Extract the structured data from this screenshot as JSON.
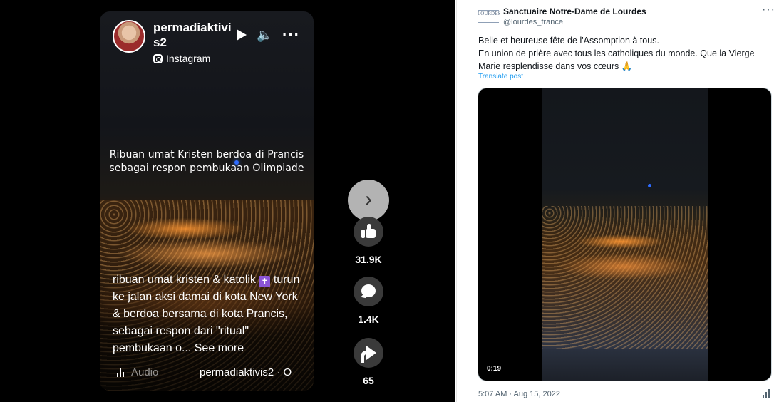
{
  "instagram": {
    "username": "permadiaktivis2",
    "source": "Instagram",
    "overlay_title_lines": [
      "Ribuan umat Kristen berdoa di Prancis",
      "sebagai respon pembukaan Olimpiade"
    ],
    "caption_part1": "ribuan umat kristen & katolik ",
    "caption_emoji": "✝",
    "caption_part2": " turun ke jalan aksi damai di kota New York & berdoa bersama di kota Prancis, sebagai respon dari \"ritual\" pembukaan o... See more",
    "audio_label": "Audio",
    "audio_author": "permadiaktivis2 · O",
    "likes": "31.9K",
    "comments": "1.4K",
    "shares": "65",
    "icons": {
      "play": "play-icon",
      "mute": "mute-icon",
      "more": "more-icon",
      "next": "chevron-right-icon",
      "like": "thumbs-up-icon",
      "comment": "comment-icon",
      "share": "share-icon",
      "audio": "audio-wave-icon"
    }
  },
  "tweet": {
    "logo_text": "LOURDES",
    "author_name": "Sanctuaire Notre-Dame de Lourdes",
    "handle": "@lourdes_france",
    "text_lines": [
      "Belle et heureuse fête de l'Assomption à tous.",
      "En union de prière avec tous les catholiques du monde. Que la Vierge",
      "Marie resplendisse dans vos cœurs 🙏"
    ],
    "translate_label": "Translate post",
    "video_duration": "0:19",
    "timestamp": "5:07 AM · Aug 15, 2022",
    "link_color": "#1d9bf0"
  }
}
